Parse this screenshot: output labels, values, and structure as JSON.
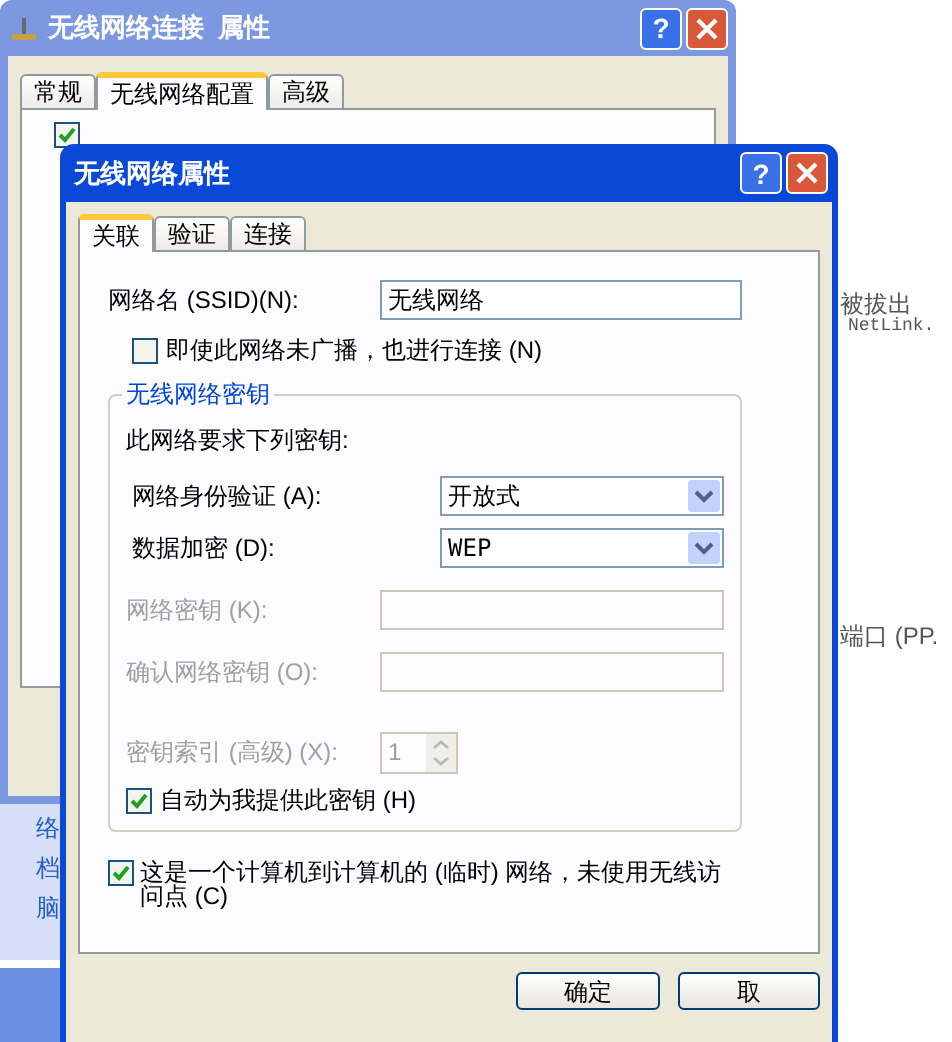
{
  "background": {
    "sidebar_items": [
      "络",
      "档",
      "脑"
    ],
    "right_texts": [
      "被拔出",
      "NetLink.",
      "端口 (PP."
    ]
  },
  "back_window": {
    "title": "无线网络连接  属性",
    "help": "?",
    "tabs": [
      {
        "label": "常规",
        "selected": false
      },
      {
        "label": "无线网络配置",
        "selected": true
      },
      {
        "label": "高级",
        "selected": false
      }
    ],
    "checkbox_checked": true
  },
  "dialog": {
    "title": "无线网络属性",
    "help": "?",
    "tabs": [
      {
        "label": "关联",
        "selected": true
      },
      {
        "label": "验证",
        "selected": false
      },
      {
        "label": "连接",
        "selected": false
      }
    ],
    "ssid_label": "网络名 (SSID)(N):",
    "ssid_value": "无线网络",
    "broadcast": {
      "label": "即使此网络未广播，也进行连接 (N)",
      "checked": false
    },
    "key_group": {
      "title": "无线网络密钥",
      "intro": "此网络要求下列密钥:",
      "fields": [
        {
          "kind": "select",
          "label": "网络身份验证 (A):",
          "value": "开放式",
          "disabled": false
        },
        {
          "kind": "select",
          "label": "数据加密 (D):",
          "value": "WEP",
          "disabled": false
        },
        {
          "kind": "text",
          "label": "网络密钥 (K):",
          "disabled": true
        },
        {
          "kind": "text",
          "label": "确认网络密钥 (O):",
          "disabled": true
        },
        {
          "kind": "spin",
          "label": "密钥索引 (高级) (X):",
          "value": "1",
          "disabled": true
        }
      ],
      "auto_key": {
        "label": "自动为我提供此密钥 (H)",
        "checked": true
      }
    },
    "adhoc": {
      "label": "这是一个计算机到计算机的 (临时) 网络，未使用无线访问点 (C)",
      "checked": true
    },
    "buttons": [
      "确定",
      "取"
    ]
  }
}
